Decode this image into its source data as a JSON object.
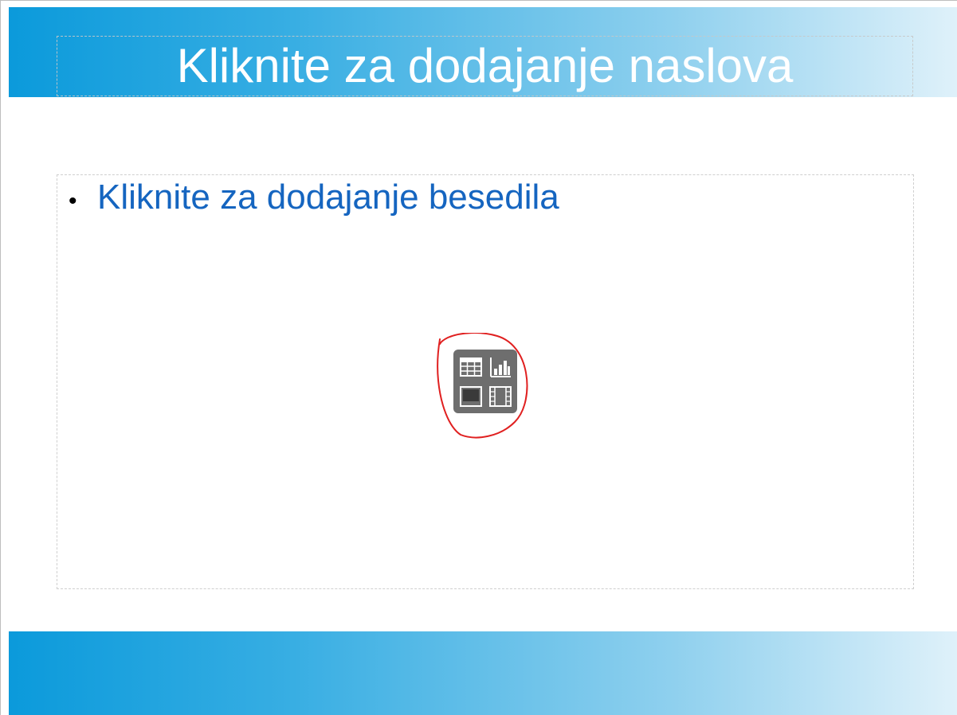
{
  "slide": {
    "title_placeholder": "Kliknite za dodajanje naslova",
    "content_placeholder": "Kliknite za dodajanje besedila",
    "bullet": "•"
  },
  "insert_panel": {
    "buttons": [
      {
        "name": "insert-table",
        "icon": "table-icon"
      },
      {
        "name": "insert-chart",
        "icon": "chart-icon"
      },
      {
        "name": "insert-image",
        "icon": "image-icon"
      },
      {
        "name": "insert-video",
        "icon": "video-icon"
      }
    ]
  },
  "colors": {
    "band_gradient_start": "#0b9adb",
    "band_gradient_end": "#dff1fa",
    "title_text": "#ffffff",
    "content_text": "#1565c0",
    "annotation": "#e02020",
    "panel_bg": "#6e6e6e"
  }
}
